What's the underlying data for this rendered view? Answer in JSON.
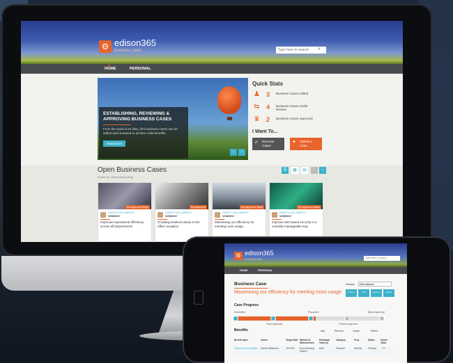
{
  "desktop": {
    "brand": {
      "name": "edison365",
      "tagline": "business case"
    },
    "search": {
      "placeholder": "Type here to search"
    },
    "nav": {
      "items": [
        {
          "label": "HOME"
        },
        {
          "label": "PERSONAL"
        }
      ]
    },
    "hero": {
      "title": "ESTABLISHING, REVIEWING & APPROVING BUSINESS CASES",
      "description": "From the seed of an idea, firm business cases can be edited and reviewed to achieve solid benefits.",
      "button": "Read More"
    },
    "quick_stats": {
      "title": "Quick Stats",
      "items": [
        {
          "icon": "people-icon",
          "value": "3",
          "label": "Business Cases Added"
        },
        {
          "icon": "review-icon",
          "value": "4",
          "label": "Business Cases Under Review"
        },
        {
          "icon": "trophy-icon",
          "value": "2",
          "label": "Business Cases Approved"
        }
      ]
    },
    "i_want_to": {
      "title": "I Want To...",
      "buttons": [
        {
          "icon": "rocket-icon",
          "label": "Discover Cases",
          "color": "#555555"
        },
        {
          "icon": "bulb-icon",
          "label": "Submit a Case",
          "color": "#e8642b"
        }
      ]
    },
    "open_cases": {
      "title": "Open Business Cases",
      "subtitle": "Sorted by Views (Ascending)",
      "cards": [
        {
          "tag": "Not Approved Stage",
          "author": "GARETH WILLIAMSON",
          "date": "02/08/2017",
          "title": "Improved operational efficiency across all Departments",
          "image": "gears"
        },
        {
          "tag": "Not Approved",
          "author": "GARETH WILLIAMSON",
          "date": "02/08/2017",
          "title": "Creating breakout areas in the office reception",
          "image": "hands"
        },
        {
          "tag": "Not Approved Stage",
          "author": "GARETH WILLIAMSON",
          "date": "02/08/2017",
          "title": "Maximising our efficiency for meeting room usage",
          "image": "office"
        },
        {
          "tag": "Not Approved Stage",
          "author": "GARETH WILLIAMSON",
          "date": "02/08/2017",
          "title": "Improve web based security in a centrally manageable way",
          "image": "security"
        }
      ]
    }
  },
  "mobile": {
    "brand": {
      "name": "edison365",
      "tagline": "business case"
    },
    "search": {
      "placeholder": "Type here to search"
    },
    "nav": {
      "items": [
        {
          "label": "HOME"
        },
        {
          "label": "PERSONAL"
        }
      ]
    },
    "section_title": "Business Case",
    "version_label": "Version",
    "version_value": "Edit selection",
    "case_title": "Maximising our efficiency for meeting room usage",
    "actions": [
      "Submit",
      "Edit",
      "Approve",
      "Reject"
    ],
    "progress": {
      "title": "Case Progress",
      "stages": [
        "Submitted",
        "Team Approval",
        "Proposed",
        "Finance Approval",
        "Board Approval"
      ],
      "fraction": 0.55
    },
    "benefits": {
      "title": "Benefits",
      "tools": [
        "Add",
        "Remove",
        "Graph",
        "Select"
      ],
      "columns": [
        "Benefit name",
        "Owner",
        "Target Date",
        "Method of Measurement",
        "Estimated Value (£)",
        "Category",
        "Freq.",
        "Status",
        "Actual Value"
      ],
      "rows": [
        [
          "Improve room utilisation",
          "Gareth Williamson",
          "31/07/18",
          "Room Booking System",
          "£44k",
          "Financial",
          "Monthly",
          "Pending",
          "£0k"
        ]
      ]
    }
  },
  "colors": {
    "accent": "#e8642b",
    "teal": "#3bb2c9",
    "nav": "#494b4e"
  }
}
